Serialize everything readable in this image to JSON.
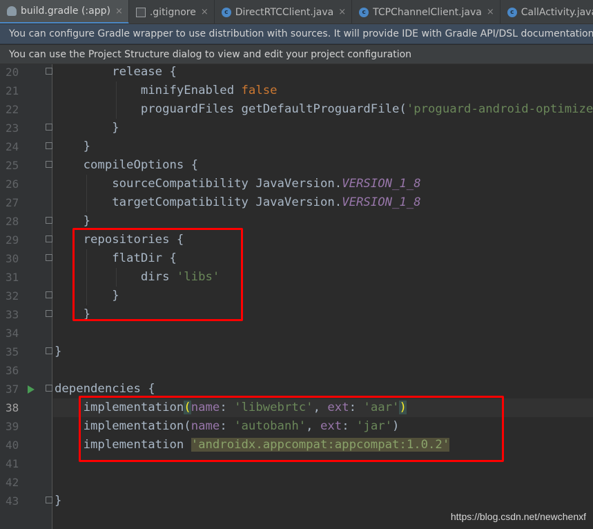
{
  "tabs": [
    {
      "label": "build.gradle (:app)",
      "icon": "gradle-icon",
      "active": true
    },
    {
      "label": ".gitignore",
      "icon": "file-icon",
      "active": false
    },
    {
      "label": "DirectRTCClient.java",
      "icon": "class-icon",
      "active": false
    },
    {
      "label": "TCPChannelClient.java",
      "icon": "class-icon",
      "active": false
    },
    {
      "label": "CallActivity.java",
      "icon": "class-icon",
      "active": false
    }
  ],
  "close_glyph": "×",
  "class_icon_letter": "c",
  "banners": {
    "wrapper": "You can configure Gradle wrapper to use distribution with sources. It will provide IDE with Gradle API/DSL documentation.",
    "structure": "You can use the Project Structure dialog to view and edit your project configuration"
  },
  "line_numbers": [
    "20",
    "21",
    "22",
    "23",
    "24",
    "25",
    "26",
    "27",
    "28",
    "29",
    "30",
    "31",
    "32",
    "33",
    "34",
    "35",
    "36",
    "37",
    "38",
    "39",
    "40",
    "41",
    "42",
    "43"
  ],
  "current_line": "38",
  "code": {
    "l20": {
      "a": "        release {"
    },
    "l21": {
      "a": "            minifyEnabled ",
      "b": "false"
    },
    "l22": {
      "a": "            proguardFiles getDefaultProguardFile(",
      "b": "'proguard-android-optimize.txt'"
    },
    "l23": {
      "a": "        }"
    },
    "l24": {
      "a": "    }"
    },
    "l25": {
      "a": "    compileOptions {"
    },
    "l26": {
      "a": "        sourceCompatibility JavaVersion.",
      "b": "VERSION_1_8"
    },
    "l27": {
      "a": "        targetCompatibility JavaVersion.",
      "b": "VERSION_1_8"
    },
    "l28": {
      "a": "    }"
    },
    "l29": {
      "a": "    repositories {"
    },
    "l30": {
      "a": "        flatDir {"
    },
    "l31": {
      "a": "            dirs ",
      "b": "'libs'"
    },
    "l32": {
      "a": "        }"
    },
    "l33": {
      "a": "    }"
    },
    "l35": {
      "a": "}"
    },
    "l37": {
      "a": "dependencies {"
    },
    "l38": {
      "a": "    implementation",
      "p1": "(",
      "n1": "name",
      "c1": ": ",
      "s1": "'libwebrtc'",
      "c2": ", ",
      "n2": "ext",
      "c3": ": ",
      "s2": "'aar'",
      "p2": ")"
    },
    "l39": {
      "a": "    implementation(",
      "n1": "name",
      "c1": ": ",
      "s1": "'autobanh'",
      "c2": ", ",
      "n2": "ext",
      "c3": ": ",
      "s2": "'jar'",
      "p2": ")"
    },
    "l40": {
      "a": "    implementation ",
      "s1": "'androidx.appcompat:appcompat:1.0.2'"
    },
    "l43": {
      "a": "}"
    }
  },
  "watermark": "https://blog.csdn.net/newchenxf",
  "colors": {
    "annotation": "#ff0000",
    "keyword": "#cc7832",
    "string": "#6a8759",
    "constant": "#9876aa"
  }
}
